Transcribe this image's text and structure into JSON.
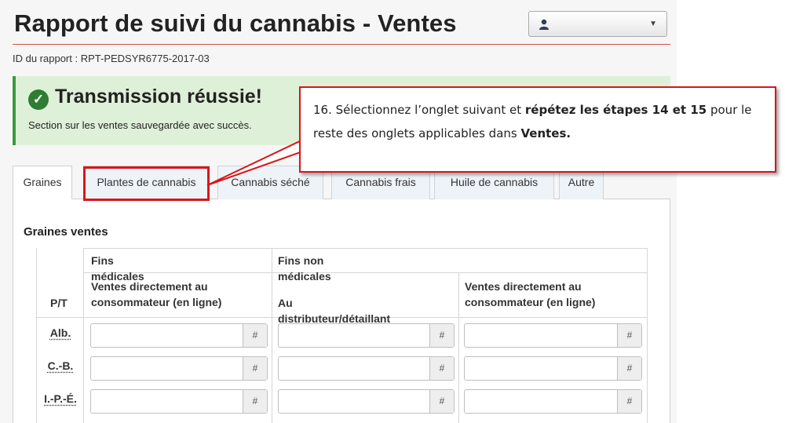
{
  "header": {
    "title": "Rapport de suivi du cannabis - Ventes",
    "report_id": "ID du rapport : RPT-PEDSYR6775-2017-03"
  },
  "alert": {
    "title": "Transmission réussie!",
    "message": "Section sur les ventes sauvegardée avec succès."
  },
  "tabs": [
    {
      "label": "Graines",
      "active": true
    },
    {
      "label": "Plantes de cannabis",
      "active": false
    },
    {
      "label": "Cannabis séché",
      "active": false
    },
    {
      "label": "Cannabis frais",
      "active": false
    },
    {
      "label": "Huile de cannabis",
      "active": false
    },
    {
      "label": "Autre",
      "active": false
    }
  ],
  "section_title": "Graines ventes",
  "table": {
    "col_groups": [
      "Fins médicales",
      "Fins non médicales"
    ],
    "pt_header": "P/T",
    "columns": [
      "Ventes directement au consommateur (en ligne)",
      "Au distributeur/détaillant",
      "Ventes directement au consommateur (en ligne)"
    ],
    "rows": [
      "Alb.",
      "C.-B.",
      "I.-P.-É."
    ],
    "addon": "#"
  },
  "callout": {
    "part1": "16. Sélectionnez l’onglet suivant et ",
    "bold1": "répétez les étapes 14 et 15",
    "part2": " pour le reste des onglets applicables dans ",
    "bold2": "Ventes."
  },
  "colors": {
    "accent_red": "#d9151b",
    "success_green": "#3c9a3c",
    "success_bg": "#dff0d8"
  }
}
